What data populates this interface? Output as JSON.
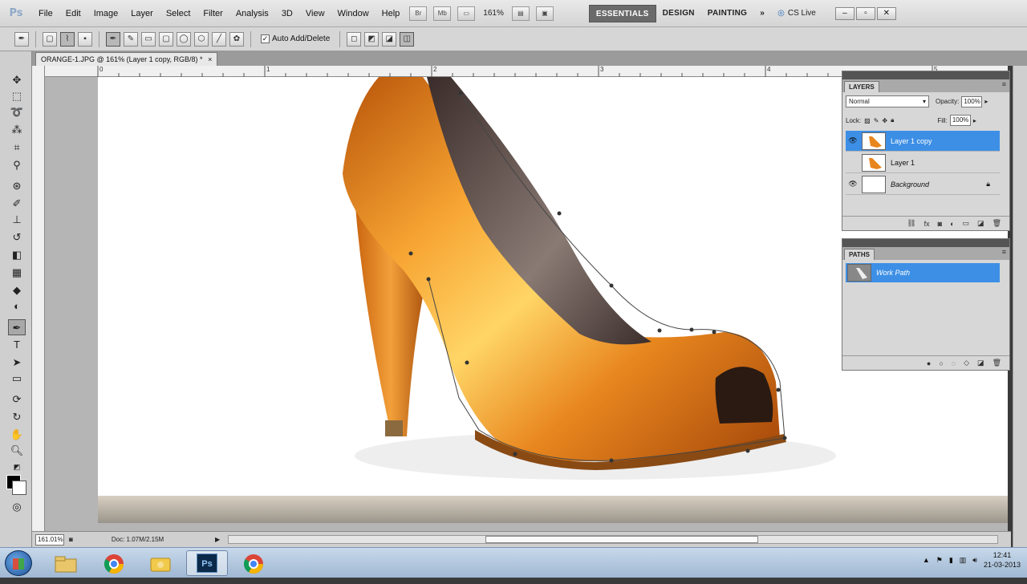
{
  "app": {
    "logo": "Ps"
  },
  "menu": [
    "File",
    "Edit",
    "Image",
    "Layer",
    "Select",
    "Filter",
    "Analysis",
    "3D",
    "View",
    "Window",
    "Help"
  ],
  "menubar": {
    "zoom": "161%",
    "workspaces": [
      "ESSENTIALS",
      "DESIGN",
      "PAINTING"
    ],
    "more": "»",
    "cs_live": "CS Live"
  },
  "options": {
    "auto_add_delete": "Auto Add/Delete"
  },
  "document": {
    "tab_title": "ORANGE-1.JPG @ 161% (Layer 1 copy, RGB/8) *",
    "tab_close": "×"
  },
  "ruler": {
    "h_ticks": [
      "0",
      "1",
      "2",
      "3",
      "4",
      "5"
    ]
  },
  "status": {
    "zoom": "161.01%",
    "doc_size": "Doc: 1.07M/2.15M"
  },
  "layers_panel": {
    "tab": "LAYERS",
    "blend_mode": "Normal",
    "opacity_label": "Opacity:",
    "opacity_value": "100%",
    "lock_label": "Lock:",
    "fill_label": "Fill:",
    "fill_value": "100%",
    "layers": [
      {
        "name": "Layer 1 copy",
        "selected": true,
        "visible": true
      },
      {
        "name": "Layer 1",
        "selected": false,
        "visible": false
      },
      {
        "name": "Background",
        "selected": false,
        "visible": true,
        "locked": true
      }
    ]
  },
  "paths_panel": {
    "tab": "PATHS",
    "paths": [
      {
        "name": "Work Path",
        "selected": true
      }
    ]
  },
  "taskbar": {
    "apps": [
      "explorer-icon",
      "chrome-icon",
      "folder-icon",
      "photoshop-icon",
      "chrome-icon"
    ],
    "ps_label": "Ps",
    "time": "12:41",
    "date": "21-03-2013"
  },
  "colors": {
    "selection_blue": "#3d8fe6",
    "shoe_orange": "#e8861e"
  }
}
